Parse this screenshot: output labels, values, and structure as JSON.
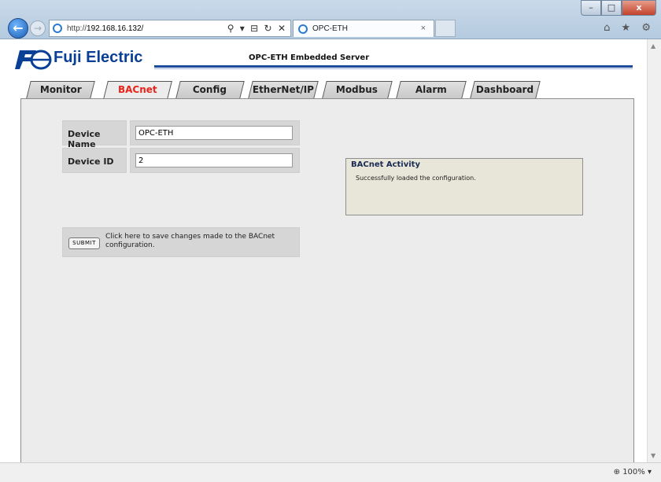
{
  "browser": {
    "address_prefix": "http://",
    "address_host": "192.168.16.132/",
    "tab_title": "OPC-ETH",
    "tab_close": "×",
    "back_symbol": "←",
    "forward_symbol": "→",
    "address_tools": "⚲ ▾ ⊟ ↻ ✕",
    "toolbar_icons": "⌂ ★ ⚙",
    "win_min": "–",
    "win_max": "□",
    "win_close": "x",
    "zoom": "⊕ 100%  ▾"
  },
  "page": {
    "brand": "Fuji Electric",
    "server_title": "OPC-ETH Embedded Server",
    "tabs": [
      {
        "label": "Monitor"
      },
      {
        "label": "BACnet"
      },
      {
        "label": "Config"
      },
      {
        "label": "EtherNet/IP"
      },
      {
        "label": "Modbus"
      },
      {
        "label": "Alarm"
      },
      {
        "label": "Dashboard"
      }
    ],
    "active_tab": "BACnet",
    "device_name_label": "Device Name",
    "device_name_value": "OPC-ETH",
    "device_id_label": "Device ID",
    "device_id_value": "2",
    "submit_label": "SUBMIT",
    "submit_text": "Click here to save changes made to the BACnet configuration.",
    "activity_title": "BACnet Activity",
    "activity_message": "Successfully loaded the configuration."
  },
  "colors": {
    "brand_blue": "#0a3f96",
    "active_tab_red": "#e8241b",
    "activity_bg": "#e7e6d8"
  }
}
